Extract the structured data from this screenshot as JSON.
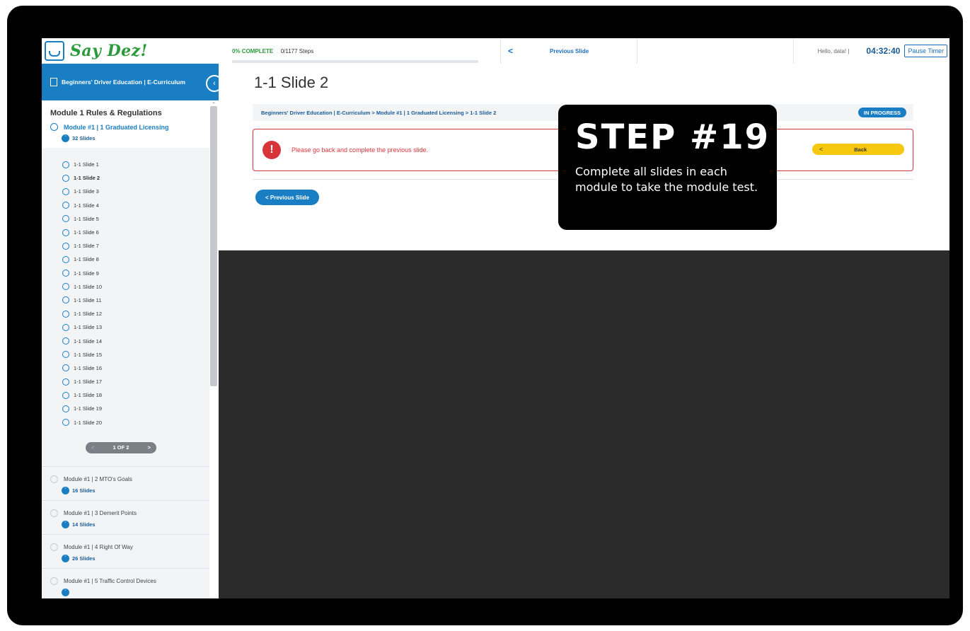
{
  "header": {
    "logo_text": "Say Dez!",
    "progress_pct": "0% COMPLETE",
    "progress_steps": "0/1177 Steps",
    "progress_value": 0,
    "prev_chevron": "<",
    "prev_label": "Previous Slide",
    "hello": "Hello, data! |",
    "timer": "04:32:40",
    "pause_label": "Pause Timer"
  },
  "sidebar": {
    "course_title": "Beginners' Driver Education | E-Curriculum",
    "collapse_icon": "chevron-left-icon",
    "module_heading": "Module 1 Rules & Regulations",
    "current_module": {
      "label": "Module #1 | 1 Graduated Licensing",
      "slides_count": "32 Slides"
    },
    "slides": [
      "1-1 Slide 1",
      "1-1 Slide 2",
      "1-1 Slide 3",
      "1-1 Slide 4",
      "1-1 Slide 5",
      "1-1 Slide 6",
      "1-1 Slide 7",
      "1-1 Slide 8",
      "1-1 Slide 9",
      "1-1 Slide 10",
      "1-1 Slide 11",
      "1-1 Slide 12",
      "1-1 Slide 13",
      "1-1 Slide 14",
      "1-1 Slide 15",
      "1-1 Slide 16",
      "1-1 Slide 17",
      "1-1 Slide 18",
      "1-1 Slide 19",
      "1-1 Slide 20"
    ],
    "active_slide_index": 1,
    "pager": {
      "prev": "<",
      "label": "1 OF 2",
      "next": ">"
    },
    "other_modules": [
      {
        "name": "Module #1 | 2 MTO's Goals",
        "slides": "16 Slides"
      },
      {
        "name": "Module #1 | 3 Demerit Points",
        "slides": "14 Slides"
      },
      {
        "name": "Module #1 | 4 Right Of Way",
        "slides": "26 Slides"
      },
      {
        "name": "Module #1 | 5 Traffic Control Devices",
        "slides": ""
      }
    ]
  },
  "main": {
    "slide_title": "1-1 Slide 2",
    "breadcrumb": "Beginners' Driver Education | E-Curriculum > Module #1 | 1 Graduated Licensing > 1-1 Slide 2",
    "status_badge": "IN PROGRESS",
    "alert_icon": "!",
    "alert_message": "Please go back and complete the previous slide.",
    "back_chevron": "<",
    "back_label": "Back",
    "prev_button": "< Previous Slide"
  },
  "callout": {
    "step": "STEP #19",
    "description": "Complete all slides in each module to take the module test."
  },
  "colors": {
    "brand_blue": "#1a7ec4",
    "brand_green": "#2a9b3a",
    "alert_red": "#d9343a",
    "back_yellow": "#f6c80f"
  }
}
